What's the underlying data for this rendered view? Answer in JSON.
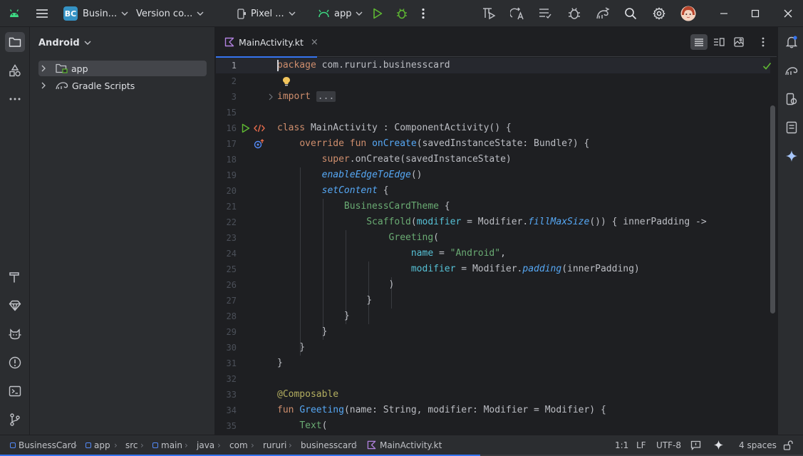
{
  "colors": {
    "accent": "#3574f0",
    "project_badge": "#3592c4",
    "check": "#5fb832"
  },
  "topbar": {
    "project_badge": "BC",
    "project_name": "Busin...",
    "vcs": "Version co...",
    "device": "Pixel ...",
    "run_config": "app"
  },
  "project_panel": {
    "view_mode": "Android",
    "tree": [
      {
        "label": "app",
        "icon": "module-folder-icon",
        "selected": true
      },
      {
        "label": "Gradle Scripts",
        "icon": "gradle-icon",
        "selected": false
      }
    ]
  },
  "editor": {
    "tab_label": "MainActivity.kt",
    "close_glyph": "×",
    "fold_placeholder": "...",
    "inspection_status": "no-problems",
    "line_numbers": [
      "1",
      "2",
      "3",
      "15",
      "16",
      "17",
      "18",
      "19",
      "20",
      "21",
      "22",
      "23",
      "24",
      "25",
      "26",
      "27",
      "28",
      "29",
      "30",
      "31",
      "32",
      "33",
      "34",
      "35"
    ]
  },
  "statusbar": {
    "breadcrumbs": [
      "BusinessCard",
      "app",
      "src",
      "main",
      "java",
      "com",
      "rururi",
      "businesscard",
      "MainActivity.kt"
    ],
    "position": "1:1",
    "line_separator": "LF",
    "encoding": "UTF-8",
    "indent": "4 spaces",
    "progress": 0.6
  }
}
